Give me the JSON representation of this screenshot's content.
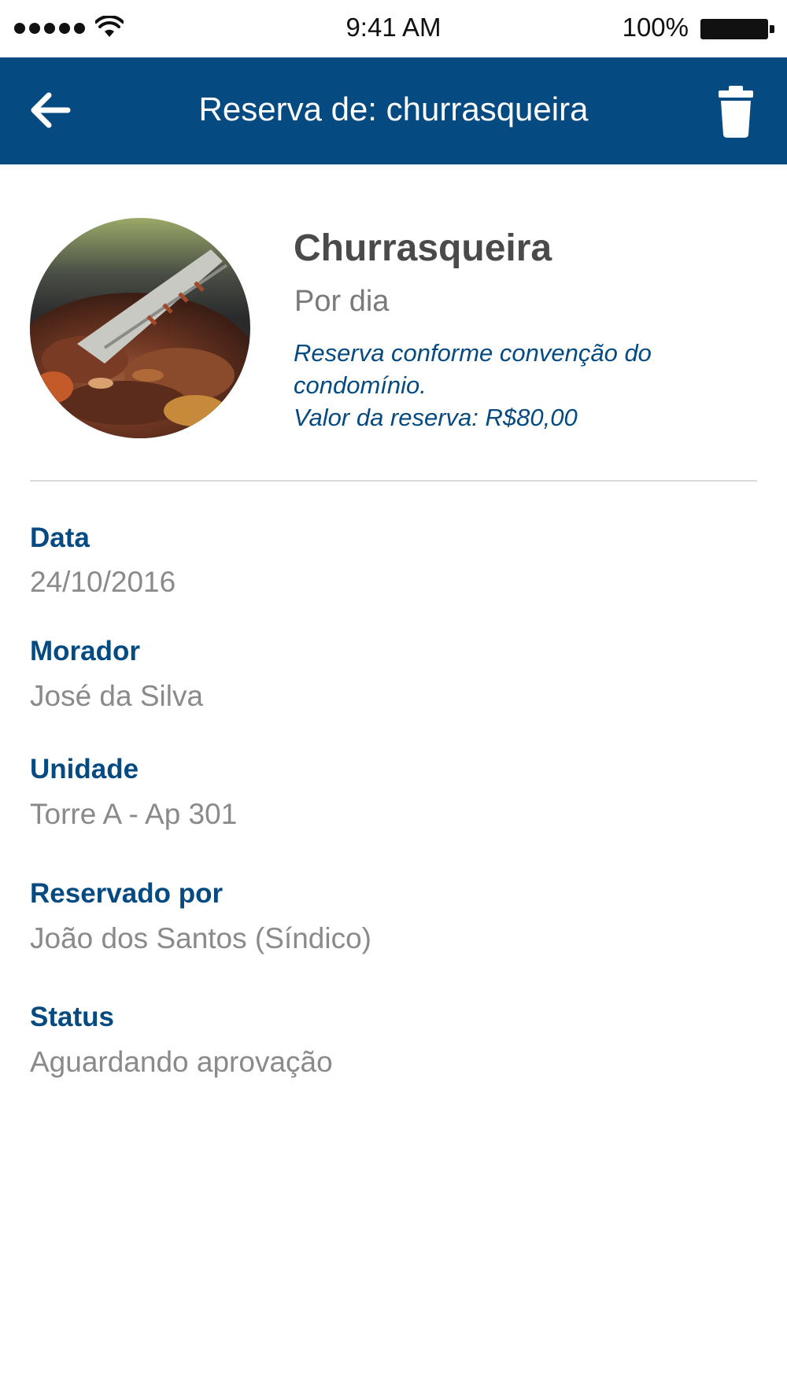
{
  "status_bar": {
    "time": "9:41 AM",
    "battery": "100%",
    "icons": [
      "signal-dots-icon",
      "wifi-icon",
      "battery-icon"
    ]
  },
  "header": {
    "title": "Reserva de: churrasqueira",
    "back_icon": "arrow-left-icon",
    "delete_icon": "trash-icon",
    "color": "#054a80"
  },
  "amenity": {
    "name": "Churrasqueira",
    "period": "Por dia",
    "notes": [
      "Reserva conforme convenção do",
      "condomínio.",
      "Valor da reserva: R$80,00"
    ]
  },
  "details": {
    "date": {
      "label": "Data",
      "value": "24/10/2016"
    },
    "resident": {
      "label": "Morador",
      "value": "José da Silva"
    },
    "unit": {
      "label": "Unidade",
      "value": "Torre A - Ap 301"
    },
    "booked_by": {
      "label": "Reservado por",
      "value": "João dos Santos (Síndico)"
    },
    "status": {
      "label": "Status",
      "value": "Aguardando aprovação"
    }
  },
  "colors": {
    "accent": "#054a80",
    "label": "#054a80",
    "value": "#8a8a8a",
    "title": "#4a4a4a"
  }
}
